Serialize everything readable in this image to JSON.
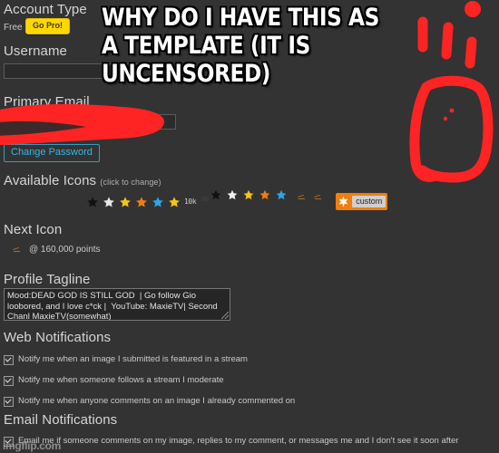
{
  "meme": {
    "caption": "WHY DO I HAVE THIS AS\nA TEMPLATE (IT IS UNCENSORED)",
    "watermark": "imgflip.com",
    "drawing_color": "#ff2424"
  },
  "page": {
    "background": "#333333",
    "accent_blue": "#36b7e4",
    "accent_yellow": "#fcd703",
    "accent_orange": "#f07d10"
  },
  "account_type": {
    "title": "Account Type",
    "plan": "Free",
    "upgrade_button": "Go Pro!"
  },
  "username": {
    "title": "Username",
    "value": ""
  },
  "primary_email": {
    "title": "Primary Email",
    "value": "",
    "change_password_button": "Change Password"
  },
  "available_icons": {
    "title": "Available Icons",
    "hint": "(click to change)",
    "items": [
      {
        "name": "person-icon-gray",
        "type": "person",
        "color": "#bdbdbd"
      },
      {
        "name": "person-icon-white",
        "type": "person",
        "color": "#ffffff"
      },
      {
        "name": "person-icon-yellow",
        "type": "person",
        "color": "#f5c518"
      },
      {
        "name": "person-icon-orange",
        "type": "person",
        "color": "#f07d10"
      },
      {
        "name": "person-icon-blue",
        "type": "person",
        "color": "#2aa7e8"
      },
      {
        "name": "star-icon-black",
        "type": "star",
        "color": "#111111"
      },
      {
        "name": "star-icon-white",
        "type": "star",
        "color": "#e8e8e8"
      },
      {
        "name": "star-icon-yellow",
        "type": "star",
        "color": "#f5c518"
      },
      {
        "name": "star-icon-orange",
        "type": "star",
        "color": "#f07d10"
      },
      {
        "name": "star-icon-blue",
        "type": "star",
        "color": "#2aa7e8"
      },
      {
        "name": "sheriff-star-icon",
        "type": "star",
        "color": "#f5c518"
      },
      {
        "name": "ten-k-icon",
        "type": "text",
        "label": "10k"
      },
      {
        "name": "comment-badge-icon",
        "type": "badge"
      },
      {
        "name": "flag-star-icon-black",
        "type": "flag",
        "color": "#111111"
      },
      {
        "name": "flag-star-icon-white",
        "type": "flag",
        "color": "#f2f2f2"
      },
      {
        "name": "flag-star-icon-yellow",
        "type": "flag",
        "color": "#f5c518"
      },
      {
        "name": "flag-star-icon-orange",
        "type": "flag",
        "color": "#f07d10"
      },
      {
        "name": "flag-star-icon-blue",
        "type": "flag",
        "color": "#2aa7e8"
      },
      {
        "name": "locked-icon-1",
        "type": "dash"
      },
      {
        "name": "locked-icon-2",
        "type": "dash"
      }
    ],
    "custom_button": "custom"
  },
  "next_icon": {
    "title": "Next Icon",
    "requirement": "@ 160,000 points"
  },
  "profile_tagline": {
    "title": "Profile Tagline",
    "value": "Mood:DEAD GOD IS STILL GOD  | Go follow Gio loobored, and I love c*ck |  YouTube: MaxieTV| Second Chanl MaxieTV(somewhat)"
  },
  "web_notifications": {
    "title": "Web Notifications",
    "options": [
      {
        "label": "Notify me when an image I submitted is featured in a stream",
        "checked": true
      },
      {
        "label": "Notify me when someone follows a stream I moderate",
        "checked": true
      },
      {
        "label": "Notify me when anyone comments on an image I already commented on",
        "checked": true
      }
    ]
  },
  "email_notifications": {
    "title": "Email Notifications",
    "options": [
      {
        "label": "Email me if someone comments on my image, replies to my comment, or messages me and I don't see it soon after",
        "checked": true
      }
    ]
  }
}
